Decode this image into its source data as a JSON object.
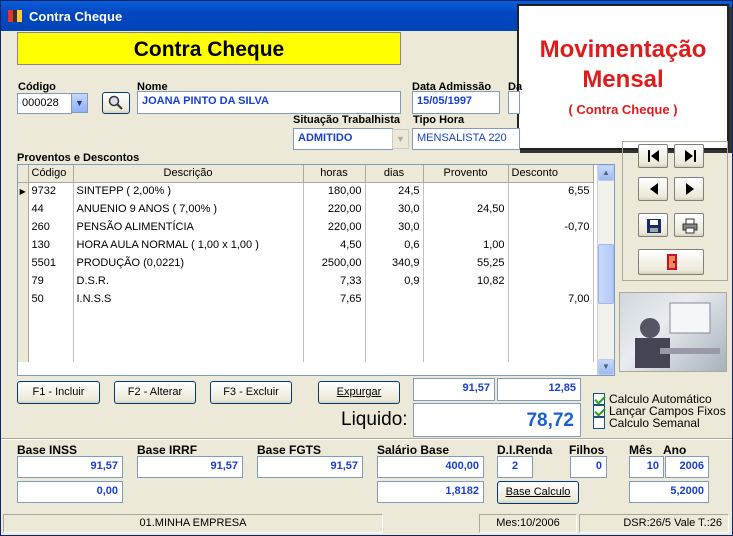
{
  "window": {
    "title": "Contra Cheque"
  },
  "header": {
    "title": "Contra Cheque"
  },
  "banner": {
    "line1": "Movimentação",
    "line2": "Mensal",
    "line3": "( Contra Cheque )"
  },
  "employee": {
    "codigo_label": "Código",
    "codigo_value": "000028",
    "nome_label": "Nome",
    "nome_value": "JOANA PINTO DA SILVA",
    "data_admissao_label": "Data Admissão",
    "data_admissao_value": "15/05/1997",
    "data_trunc_label": "Da",
    "situacao_label": "Situação Trabalhista",
    "situacao_value": "ADMITIDO",
    "tipo_hora_label": "Tipo Hora",
    "tipo_hora_value": "MENSALISTA  220"
  },
  "proventos": {
    "section_label": "Proventos e Descontos",
    "columns": [
      "Código",
      "Descrição",
      "horas",
      "dias",
      "Provento",
      "Desconto"
    ],
    "rows": [
      {
        "codigo": "9732",
        "descricao": "SINTEPP ( 2,00% )",
        "horas": "180,00",
        "dias": "24,5",
        "provento": "",
        "desconto": "6,55",
        "current": true
      },
      {
        "codigo": "44",
        "descricao": "ANUENIO 9 ANOS ( 7,00% )",
        "horas": "220,00",
        "dias": "30,0",
        "provento": "24,50",
        "desconto": "",
        "current": false
      },
      {
        "codigo": "260",
        "descricao": "PENSÃO ALIMENTÍCIA",
        "horas": "220,00",
        "dias": "30,0",
        "provento": "",
        "desconto": "-0,70",
        "current": false
      },
      {
        "codigo": "130",
        "descricao": "HORA AULA NORMAL ( 1,00 x 1,00 )",
        "horas": "4,50",
        "dias": "0,6",
        "provento": "1,00",
        "desconto": "",
        "current": false
      },
      {
        "codigo": "5501",
        "descricao": "PRODUÇÃO (0,0221)",
        "horas": "2500,00",
        "dias": "340,9",
        "provento": "55,25",
        "desconto": "",
        "current": false
      },
      {
        "codigo": "79",
        "descricao": "D.S.R.",
        "horas": "7,33",
        "dias": "0,9",
        "provento": "10,82",
        "desconto": "",
        "current": false
      },
      {
        "codigo": "50",
        "descricao": "I.N.S.S",
        "horas": "7,65",
        "dias": "",
        "provento": "",
        "desconto": "7,00",
        "current": false
      }
    ],
    "empty_rows": 3
  },
  "actions": {
    "incluir": "F1 - Incluir",
    "alterar": "F2 - Alterar",
    "excluir": "F3 - Excluir",
    "expurgar": "Expurgar"
  },
  "totals": {
    "proventos": "91,57",
    "descontos": "12,85",
    "liquido_label": "Liquido:",
    "liquido_value": "78,72"
  },
  "options": {
    "calculo_automatico": "Calculo Automático",
    "lancar_campos_fixos": "Lançar Campos Fixos",
    "calculo_semanal": "Calculo Semanal",
    "calculo_automatico_checked": true,
    "lancar_campos_fixos_checked": true,
    "calculo_semanal_checked": false
  },
  "bases": {
    "inss_label": "Base INSS",
    "inss_value": "91,57",
    "inss_value2": "0,00",
    "irrf_label": "Base IRRF",
    "irrf_value": "91,57",
    "fgts_label": "Base FGTS",
    "fgts_value": "91,57",
    "salario_label": "Salário Base",
    "salario_value": "400,00",
    "salario_value2": "1,8182",
    "direnda_label": "D.I.Renda",
    "direnda_value": "2",
    "filhos_label": "Filhos",
    "filhos_value": "0",
    "base_calculo_button": "Base Calculo",
    "mes_label": "Mês",
    "mes_value": "10",
    "ano_label": "Ano",
    "ano_value": "2006",
    "mesano_value2": "5,2000"
  },
  "status": {
    "empresa": "01.MINHA EMPRESA",
    "mes": "Mes:10/2006",
    "dsr": "DSR:26/5 Vale T.:26"
  },
  "icons": {
    "app": "app-icon",
    "search": "search-icon",
    "first": "first-record-icon",
    "last": "last-record-icon",
    "prev": "previous-record-icon",
    "next": "next-record-icon",
    "save": "save-icon",
    "print": "print-icon",
    "exit": "exit-door-icon"
  },
  "colors": {
    "title_bar": "#0347c2",
    "header_yellow": "#ffff00",
    "banner_red": "#e01b1b",
    "value_blue": "#1a3fd0"
  }
}
